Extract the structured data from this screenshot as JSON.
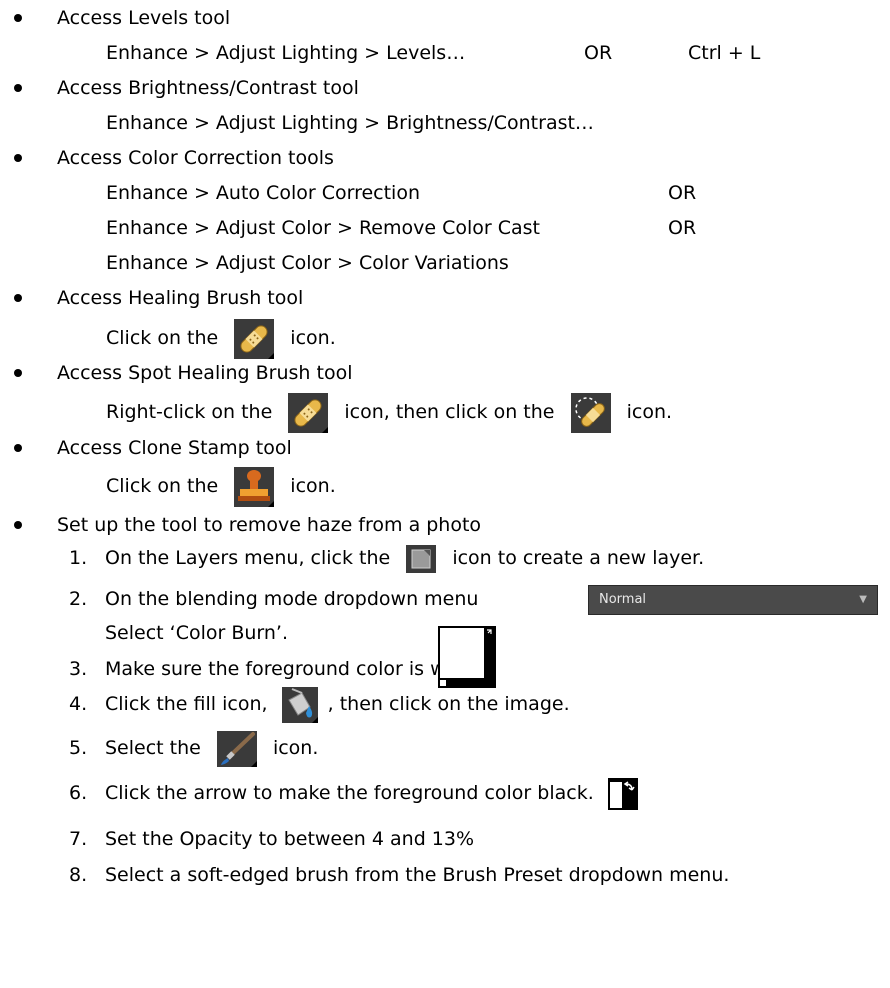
{
  "items": [
    {
      "title": "Access Levels tool",
      "lines": [
        [
          "Enhance > Adjust Lighting > Levels…",
          "OR",
          "Ctrl + L"
        ]
      ]
    },
    {
      "title": "Access Brightness/Contrast tool",
      "lines": [
        [
          "Enhance > Adjust Lighting > Brightness/Contrast…"
        ]
      ]
    },
    {
      "title": "Access Color Correction tools",
      "lines": [
        [
          "Enhance > Auto Color Correction",
          "OR"
        ],
        [
          "Enhance > Adjust Color > Remove Color Cast",
          "OR"
        ],
        [
          "Enhance > Adjust Color > Color Variations"
        ]
      ]
    },
    {
      "title": "Access Healing Brush tool",
      "detail": {
        "before": "Click on the",
        "after": "icon."
      }
    },
    {
      "title": "Access Spot Healing Brush tool",
      "detail": {
        "before": "Right-click on the",
        "middle": "icon, then click on the",
        "after": "icon."
      }
    },
    {
      "title": "Access Clone Stamp tool",
      "detail": {
        "before": "Click on the",
        "after": "icon."
      }
    },
    {
      "title": "Set up the tool to remove haze from a photo"
    }
  ],
  "steps": [
    {
      "num": "1.",
      "before": "On the Layers menu, click the",
      "after": "icon to create a new layer."
    },
    {
      "num": "2.",
      "text": "On the blending mode dropdown menu",
      "dropdown_value": "Normal",
      "line2": "Select ‘Color Burn’."
    },
    {
      "num": "3.",
      "text": "Make sure the foreground color is white:"
    },
    {
      "num": "4.",
      "before": "Click the fill icon,",
      "after": ", then click on the image."
    },
    {
      "num": "5.",
      "before": "Select the",
      "after": "icon."
    },
    {
      "num": "6.",
      "text": "Click the arrow to make the foreground color black."
    },
    {
      "num": "7.",
      "text": "Set the Opacity to between 4 and 13%"
    },
    {
      "num": "8.",
      "text": "Select a soft-edged brush from the Brush Preset dropdown menu."
    }
  ],
  "icons": {
    "healing_brush": "bandage-icon",
    "spot_healing_brush": "spot-bandage-icon",
    "clone_stamp": "stamp-icon",
    "new_layer": "new-layer-icon",
    "fill": "paint-bucket-icon",
    "brush": "brush-icon",
    "color_swatch": "color-swatch-icon",
    "swap_colors": "swap-colors-icon"
  }
}
